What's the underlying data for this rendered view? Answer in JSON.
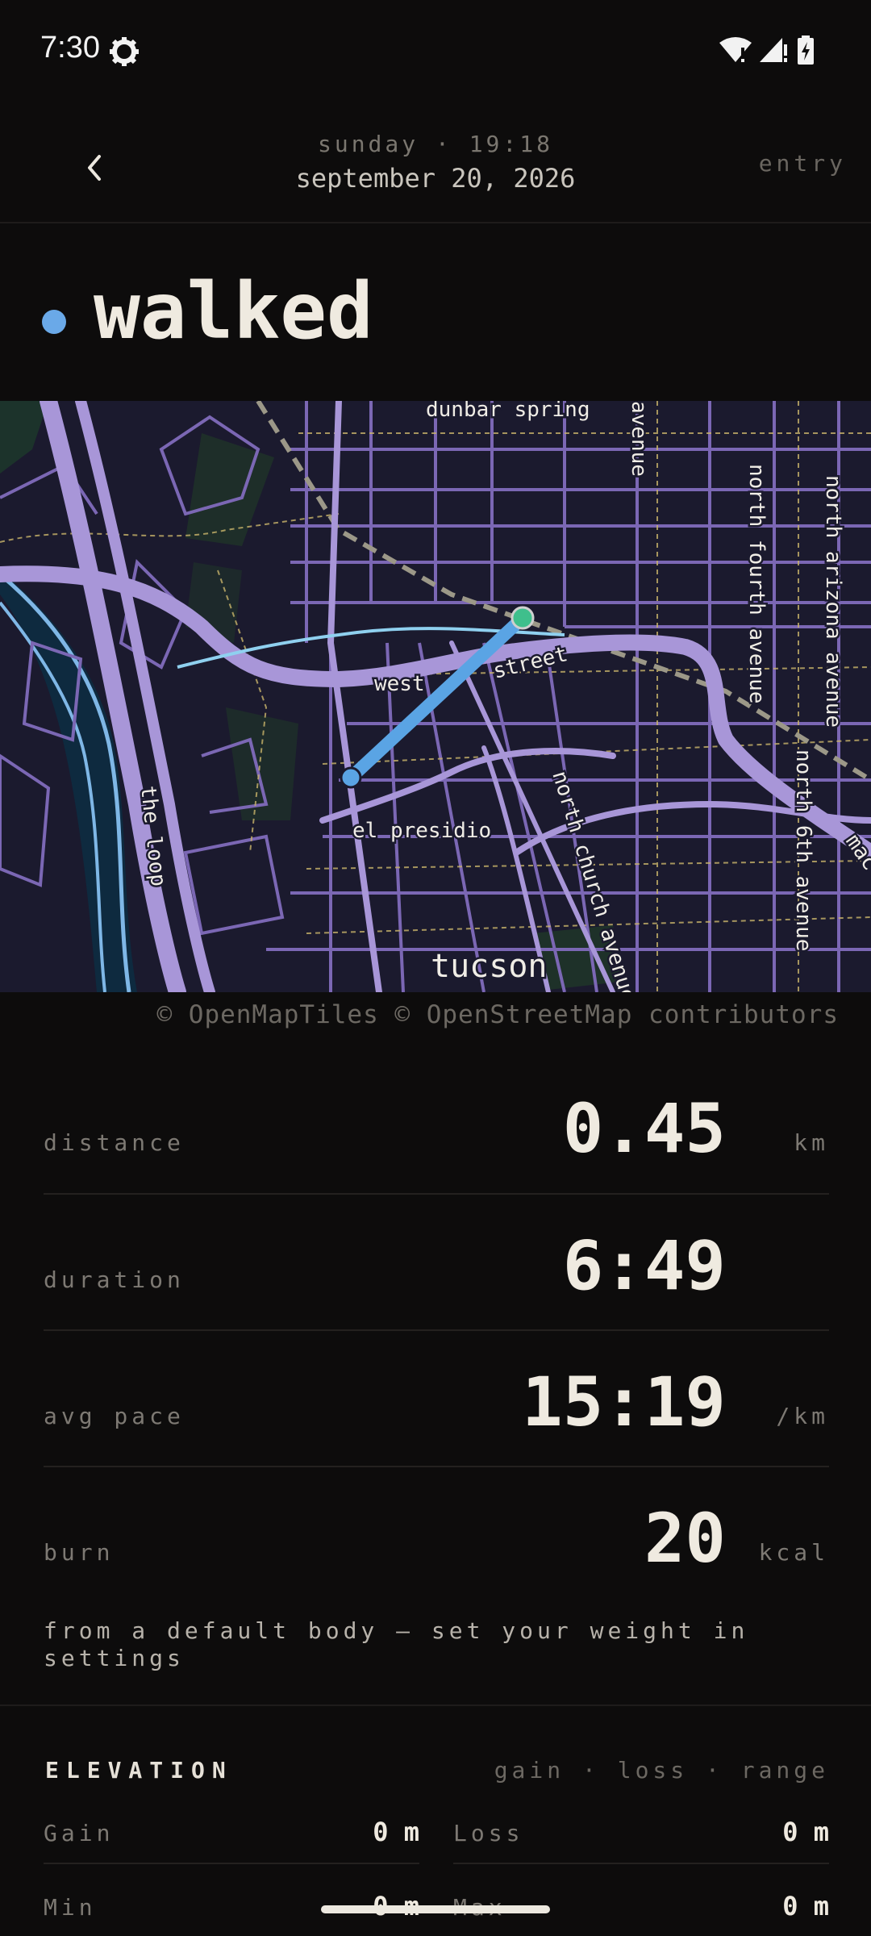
{
  "status_bar": {
    "time": "7:30"
  },
  "header": {
    "weekday_time": "sunday · 19:18",
    "date": "september 20, 2026",
    "entry_label": "entry"
  },
  "activity": {
    "title": "walked",
    "dot_color": "#6aa9e8"
  },
  "map": {
    "credit": "© OpenMapTiles © OpenStreetMap contributors",
    "labels": {
      "dunbar": "dunbar spring",
      "avenue_top": "avenue",
      "north_fourth": "north fourth avenue",
      "north_arizona": "north arizona avenue",
      "west_street": "west",
      "street": "street",
      "el_presidio": "el presidio",
      "the_loop": "the loop",
      "north_church": "north church avenue",
      "north_sixth": "north 6th avenue",
      "tucson": "tucson",
      "mac": "mac"
    },
    "route_color": "#5aa4e4",
    "start_color": "#5aa4e4",
    "end_color": "#3fbf8c"
  },
  "stats": [
    {
      "label": "distance",
      "value": "0.45",
      "unit": "km"
    },
    {
      "label": "duration",
      "value": "6:49",
      "unit": ""
    },
    {
      "label": "avg pace",
      "value": "15:19",
      "unit": "/km"
    },
    {
      "label": "burn",
      "value": "20",
      "unit": "kcal"
    }
  ],
  "stats_note": "from a default body — set your weight in settings",
  "elevation": {
    "title": "ELEVATION",
    "subtitle": "gain · loss · range",
    "items": [
      {
        "label": "Gain",
        "value": "0 m"
      },
      {
        "label": "Loss",
        "value": "0 m"
      },
      {
        "label": "Min",
        "value": "0 m"
      },
      {
        "label": "Max",
        "value": "0 m"
      }
    ]
  }
}
